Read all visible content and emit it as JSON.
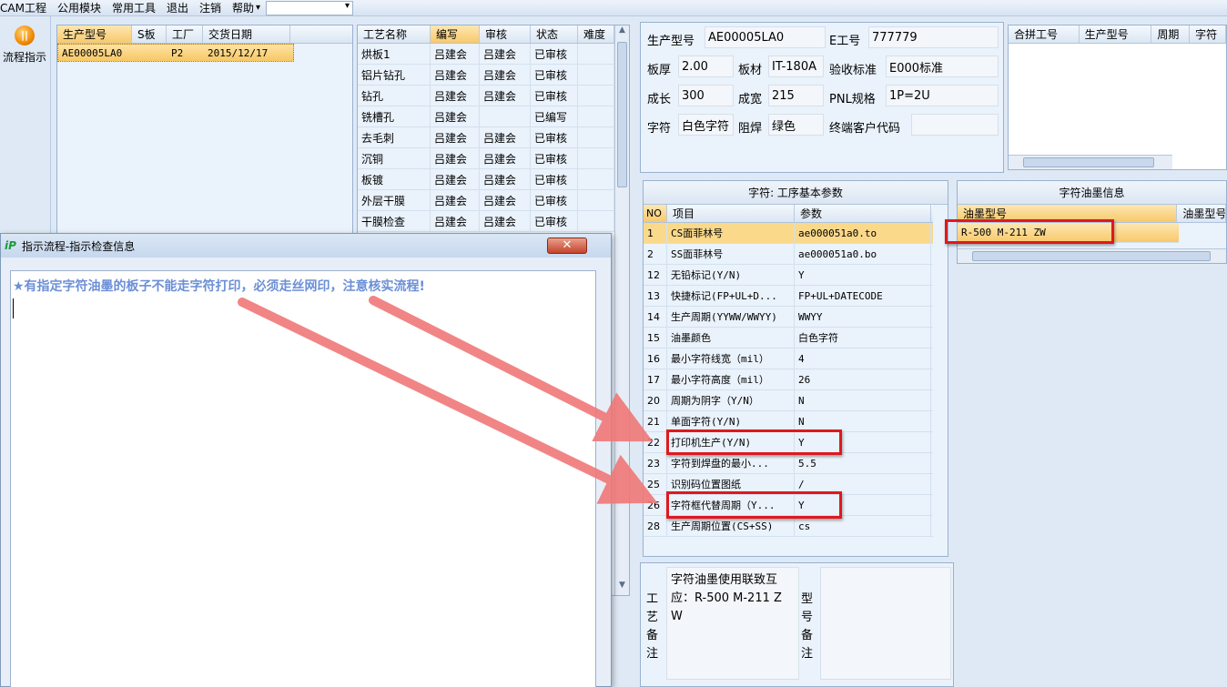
{
  "menu": {
    "items": [
      "CAM工程",
      "公用模块",
      "常用工具",
      "退出",
      "注销",
      "帮助"
    ],
    "help_arrow": "▾"
  },
  "toolbar": {
    "flow_label": "流程指示",
    "flow_icon": "pause-circle-icon"
  },
  "orders": {
    "headers": [
      "生产型号",
      "S板",
      "工厂",
      "交货日期"
    ],
    "rows": [
      {
        "model": "AE00005LA0",
        "s": "",
        "factory": "P2",
        "date": "2015/12/17"
      }
    ]
  },
  "process": {
    "headers": [
      "工艺名称",
      "编写",
      "审核",
      "状态",
      "难度"
    ],
    "rows": [
      {
        "name": "烘板1",
        "writer": "吕建会",
        "reviewer": "吕建会",
        "status": "已审核"
      },
      {
        "name": "铝片钻孔",
        "writer": "吕建会",
        "reviewer": "吕建会",
        "status": "已审核"
      },
      {
        "name": "钻孔",
        "writer": "吕建会",
        "reviewer": "吕建会",
        "status": "已审核"
      },
      {
        "name": "铣槽孔",
        "writer": "吕建会",
        "reviewer": "",
        "status": "已编写"
      },
      {
        "name": "去毛刺",
        "writer": "吕建会",
        "reviewer": "吕建会",
        "status": "已审核"
      },
      {
        "name": "沉铜",
        "writer": "吕建会",
        "reviewer": "吕建会",
        "status": "已审核"
      },
      {
        "name": "板镀",
        "writer": "吕建会",
        "reviewer": "吕建会",
        "status": "已审核"
      },
      {
        "name": "外层干膜",
        "writer": "吕建会",
        "reviewer": "吕建会",
        "status": "已审核"
      },
      {
        "name": "干膜检查",
        "writer": "吕建会",
        "reviewer": "吕建会",
        "status": "已审核"
      }
    ]
  },
  "info": {
    "model_label": "生产型号",
    "model": "AE00005LA0",
    "eno_label": "E工号",
    "eno": "777779",
    "thick_label": "板厚",
    "thick": "2.00",
    "material_label": "板材",
    "material": "IT-180A",
    "std_label": "验收标准",
    "std": "E000标准",
    "len_label": "成长",
    "len": "300",
    "wid_label": "成宽",
    "wid": "215",
    "pnl_label": "PNL规格",
    "pnl": "1P=2U",
    "char_label": "字符",
    "char": "白色字符",
    "mask_label": "阻焊",
    "mask": "绿色",
    "cust_label": "终端客户代码",
    "cust": ""
  },
  "merge": {
    "headers": [
      "合拼工号",
      "生产型号",
      "周期",
      "字符"
    ]
  },
  "params": {
    "title": "字符: 工序基本参数",
    "headers": [
      "NO",
      "项目",
      "参数"
    ],
    "rows": [
      {
        "no": "1",
        "item": "CS面菲林号",
        "value": "ae000051a0.to"
      },
      {
        "no": "2",
        "item": "SS面菲林号",
        "value": "ae000051a0.bo"
      },
      {
        "no": "12",
        "item": "无铅标记(Y/N)",
        "value": "Y"
      },
      {
        "no": "13",
        "item": "快捷标记(FP+UL+D...",
        "value": "FP+UL+DATECODE"
      },
      {
        "no": "14",
        "item": "生产周期(YYWW/WWYY)",
        "value": "WWYY"
      },
      {
        "no": "15",
        "item": "油墨颜色",
        "value": "白色字符"
      },
      {
        "no": "16",
        "item": "最小字符线宽（mil）",
        "value": "4"
      },
      {
        "no": "17",
        "item": "最小字符高度（mil）",
        "value": "26"
      },
      {
        "no": "20",
        "item": "周期为阴字（Y/N）",
        "value": "N"
      },
      {
        "no": "21",
        "item": "单面字符(Y/N)",
        "value": "N"
      },
      {
        "no": "22",
        "item": "打印机生产(Y/N)",
        "value": "Y"
      },
      {
        "no": "23",
        "item": "字符到焊盘的最小...",
        "value": "5.5"
      },
      {
        "no": "25",
        "item": "识别码位置图纸",
        "value": "/"
      },
      {
        "no": "26",
        "item": "字符框代替周期（Y...",
        "value": "Y"
      },
      {
        "no": "28",
        "item": "生产周期位置(CS+SS)",
        "value": "cs"
      }
    ]
  },
  "ink": {
    "title": "字符油墨信息",
    "headers": [
      "油墨型号",
      "油墨型号"
    ],
    "rows": [
      {
        "model": "R-500 M-211 ZW"
      }
    ]
  },
  "notes": {
    "craft_label": "工艺备注",
    "craft_text": "字符油墨使用联致互应：R-500 M-211 ZW",
    "model_label": "型号备注",
    "model_text": ""
  },
  "dialog": {
    "title": "指示流程-指示检查信息",
    "icon": "app-logo-icon",
    "message": "★有指定字符油墨的板子不能走字符打印，必须走丝网印，注意核实流程!",
    "close": "✕"
  },
  "colors": {
    "selected": "#fbd98b",
    "highlight_red": "#e0181e",
    "arrow": "#f08080",
    "message": "#6b8fd6"
  }
}
